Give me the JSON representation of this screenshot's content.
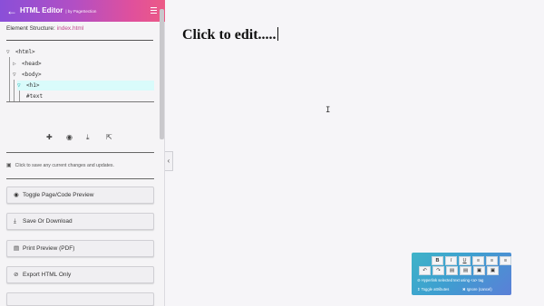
{
  "header": {
    "back_icon": "←",
    "title": "HTML Editor",
    "subtitle": "| by PageSection",
    "gradient": [
      "#8a4fd8",
      "#e0509c"
    ]
  },
  "structure": {
    "label": "Element Structure:",
    "file": "index.html"
  },
  "tree": {
    "html": "<html>",
    "head": "<head>",
    "body": "<body>",
    "h1": "<h1>",
    "text": "#text"
  },
  "tools": {
    "add_icon": "plus-icon",
    "preview_icon": "eye-icon",
    "download_icon": "download-icon",
    "export_icon": "export-icon"
  },
  "save_hint": "Click to save any current changes and updates.",
  "buttons": {
    "toggle_preview": "Toggle Page/Code Preview",
    "save_download": "Save Or Download",
    "print_preview": "Print Preview (PDF)",
    "export_html": "Export HTML Only"
  },
  "canvas": {
    "heading": "Click to edit....."
  },
  "float_toolbar": {
    "row1": [
      "B",
      "I",
      "U",
      "≡",
      "≡",
      "≡"
    ],
    "row2": [
      "↶",
      "↷",
      "▤",
      "▤",
      "▣",
      "▣"
    ],
    "hyperlink": "Hyperlink selected text using <a> tag",
    "toggle_attr": "Toggle attributes",
    "ignore_commit": "Ignore (cancel)"
  }
}
